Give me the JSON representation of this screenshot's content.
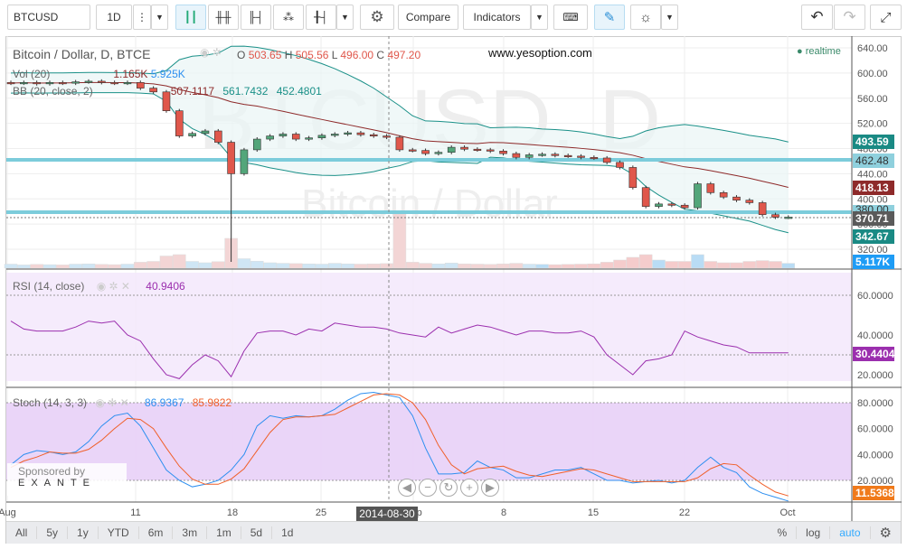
{
  "toolbar": {
    "symbol": "BTCUSD",
    "interval": "1D",
    "compare": "Compare",
    "indicators": "Indicators"
  },
  "legend": {
    "title": "Bitcoin / Dollar, D, BTCE",
    "o_label": "O",
    "o": "503.65",
    "h_label": "H",
    "h": "505.56",
    "l_label": "L",
    "l": "496.00",
    "c_label": "C",
    "c": "497.20",
    "vol": "Vol (20)",
    "vol_v1": "1.165K",
    "vol_v2": "5.925K",
    "bb": "BB (20, close, 2)",
    "bb_v1": "507.1117",
    "bb_v2": "561.7432",
    "bb_v3": "452.4801",
    "rsi": "RSI (14, close)",
    "rsi_v": "40.9406",
    "stoch": "Stoch (14, 3, 3)",
    "stoch_k": "86.9367",
    "stoch_d": "85.9822"
  },
  "watermark": {
    "big": "BTCUSD, D",
    "sub": "Bitcoin / Dollar"
  },
  "website": "www.yesoption.com",
  "realtime": "realtime",
  "price_axis": [
    "640.00",
    "600.00",
    "560.00",
    "520.00",
    "480.00",
    "440.00",
    "400.00",
    "360.00",
    "320.00"
  ],
  "price_labels": {
    "bb_upper": "493.59",
    "hline1": "462.48",
    "bb_mid": "418.13",
    "hline2": "380.00",
    "last": "370.71",
    "bb_lower": "342.67",
    "volume": "5.117K"
  },
  "rsi_axis": [
    "60.0000",
    "40.0000",
    "20.0000"
  ],
  "rsi_label": "30.4404",
  "stoch_axis": [
    "80.0000",
    "60.0000",
    "40.0000",
    "20.0000"
  ],
  "stoch_label": "11.5368",
  "time_axis": [
    "Aug",
    "11",
    "18",
    "25",
    "Sep",
    "8",
    "15",
    "22",
    "Oct"
  ],
  "crosshair_date": "2014-08-30",
  "sponsor": {
    "label": "Sponsored by",
    "brand": "EXANTE"
  },
  "ranges": [
    "All",
    "5y",
    "1y",
    "YTD",
    "6m",
    "3m",
    "1m",
    "5d",
    "1d"
  ],
  "scale_opts": {
    "pct": "%",
    "log": "log",
    "auto": "auto"
  },
  "colors": {
    "up": "#53a67a",
    "down": "#e0574b",
    "bb": "#1a9088",
    "bbmid": "#8e2a2a",
    "rsi": "#9b2fae",
    "k": "#2d8ff0",
    "d": "#f0602a",
    "hline": "#7cccdb",
    "accent": "#33aaff"
  },
  "series": {
    "close": [
      584,
      585,
      583,
      585,
      584,
      586,
      587,
      585,
      584,
      585,
      576,
      570,
      540,
      500,
      504,
      508,
      490,
      440,
      478,
      495,
      500,
      503,
      495,
      497,
      501,
      503,
      505,
      502,
      500,
      498,
      478,
      477,
      472,
      474,
      482,
      479,
      478,
      476,
      472,
      466,
      470,
      471,
      469,
      468,
      466,
      465,
      458,
      450,
      418,
      388,
      392,
      390,
      386,
      424,
      410,
      403,
      398,
      394,
      375,
      371,
      371
    ],
    "volume_k": [
      1.5,
      1.2,
      1.4,
      1.3,
      1.2,
      1.5,
      1.6,
      1.4,
      1.3,
      1.5,
      2.2,
      2.5,
      4.5,
      5.0,
      2.5,
      2.0,
      2.4,
      11.0,
      3.5,
      2.6,
      2.0,
      1.8,
      1.7,
      1.6,
      1.5,
      1.8,
      1.6,
      1.5,
      1.6,
      1.7,
      20.0,
      2.2,
      1.8,
      1.6,
      1.9,
      1.6,
      1.5,
      1.4,
      1.6,
      1.8,
      1.5,
      1.4,
      1.3,
      1.4,
      1.5,
      1.6,
      2.2,
      3.0,
      4.0,
      5.0,
      3.0,
      2.5,
      2.5,
      5.0,
      2.5,
      2.0,
      2.0,
      2.5,
      2.8,
      2.5,
      1.8
    ],
    "rsi": [
      47,
      43,
      42,
      42,
      42,
      44,
      47,
      46,
      47,
      40,
      37,
      28,
      20,
      18,
      25,
      30,
      27,
      19,
      32,
      41,
      42,
      42,
      40,
      43,
      42,
      46,
      45,
      44,
      44,
      43,
      41,
      40,
      39,
      44,
      41,
      43,
      45,
      44,
      42,
      40,
      42,
      42,
      41,
      41,
      42,
      39,
      30,
      25,
      20,
      27,
      28,
      30,
      42,
      39,
      37,
      35,
      34,
      31,
      31,
      31,
      31
    ],
    "stoch_k": [
      32,
      40,
      43,
      42,
      40,
      42,
      50,
      62,
      70,
      72,
      62,
      45,
      28,
      20,
      15,
      17,
      20,
      28,
      40,
      62,
      70,
      68,
      70,
      69,
      70,
      75,
      82,
      87,
      88,
      86,
      84,
      70,
      45,
      25,
      25,
      26,
      35,
      30,
      28,
      22,
      22,
      25,
      28,
      28,
      30,
      25,
      20,
      20,
      18,
      19,
      20,
      18,
      20,
      30,
      38,
      30,
      26,
      15,
      10,
      7,
      4
    ],
    "stoch_d": [
      30,
      35,
      38,
      42,
      41,
      41,
      44,
      51,
      60,
      68,
      67,
      60,
      45,
      31,
      21,
      17,
      17,
      21,
      29,
      43,
      57,
      67,
      69,
      69,
      70,
      71,
      76,
      81,
      86,
      87,
      86,
      80,
      67,
      47,
      32,
      25,
      29,
      30,
      31,
      27,
      24,
      23,
      25,
      27,
      29,
      28,
      25,
      22,
      19,
      19,
      19,
      19,
      19,
      22,
      29,
      33,
      32,
      24,
      17,
      11,
      8
    ]
  }
}
